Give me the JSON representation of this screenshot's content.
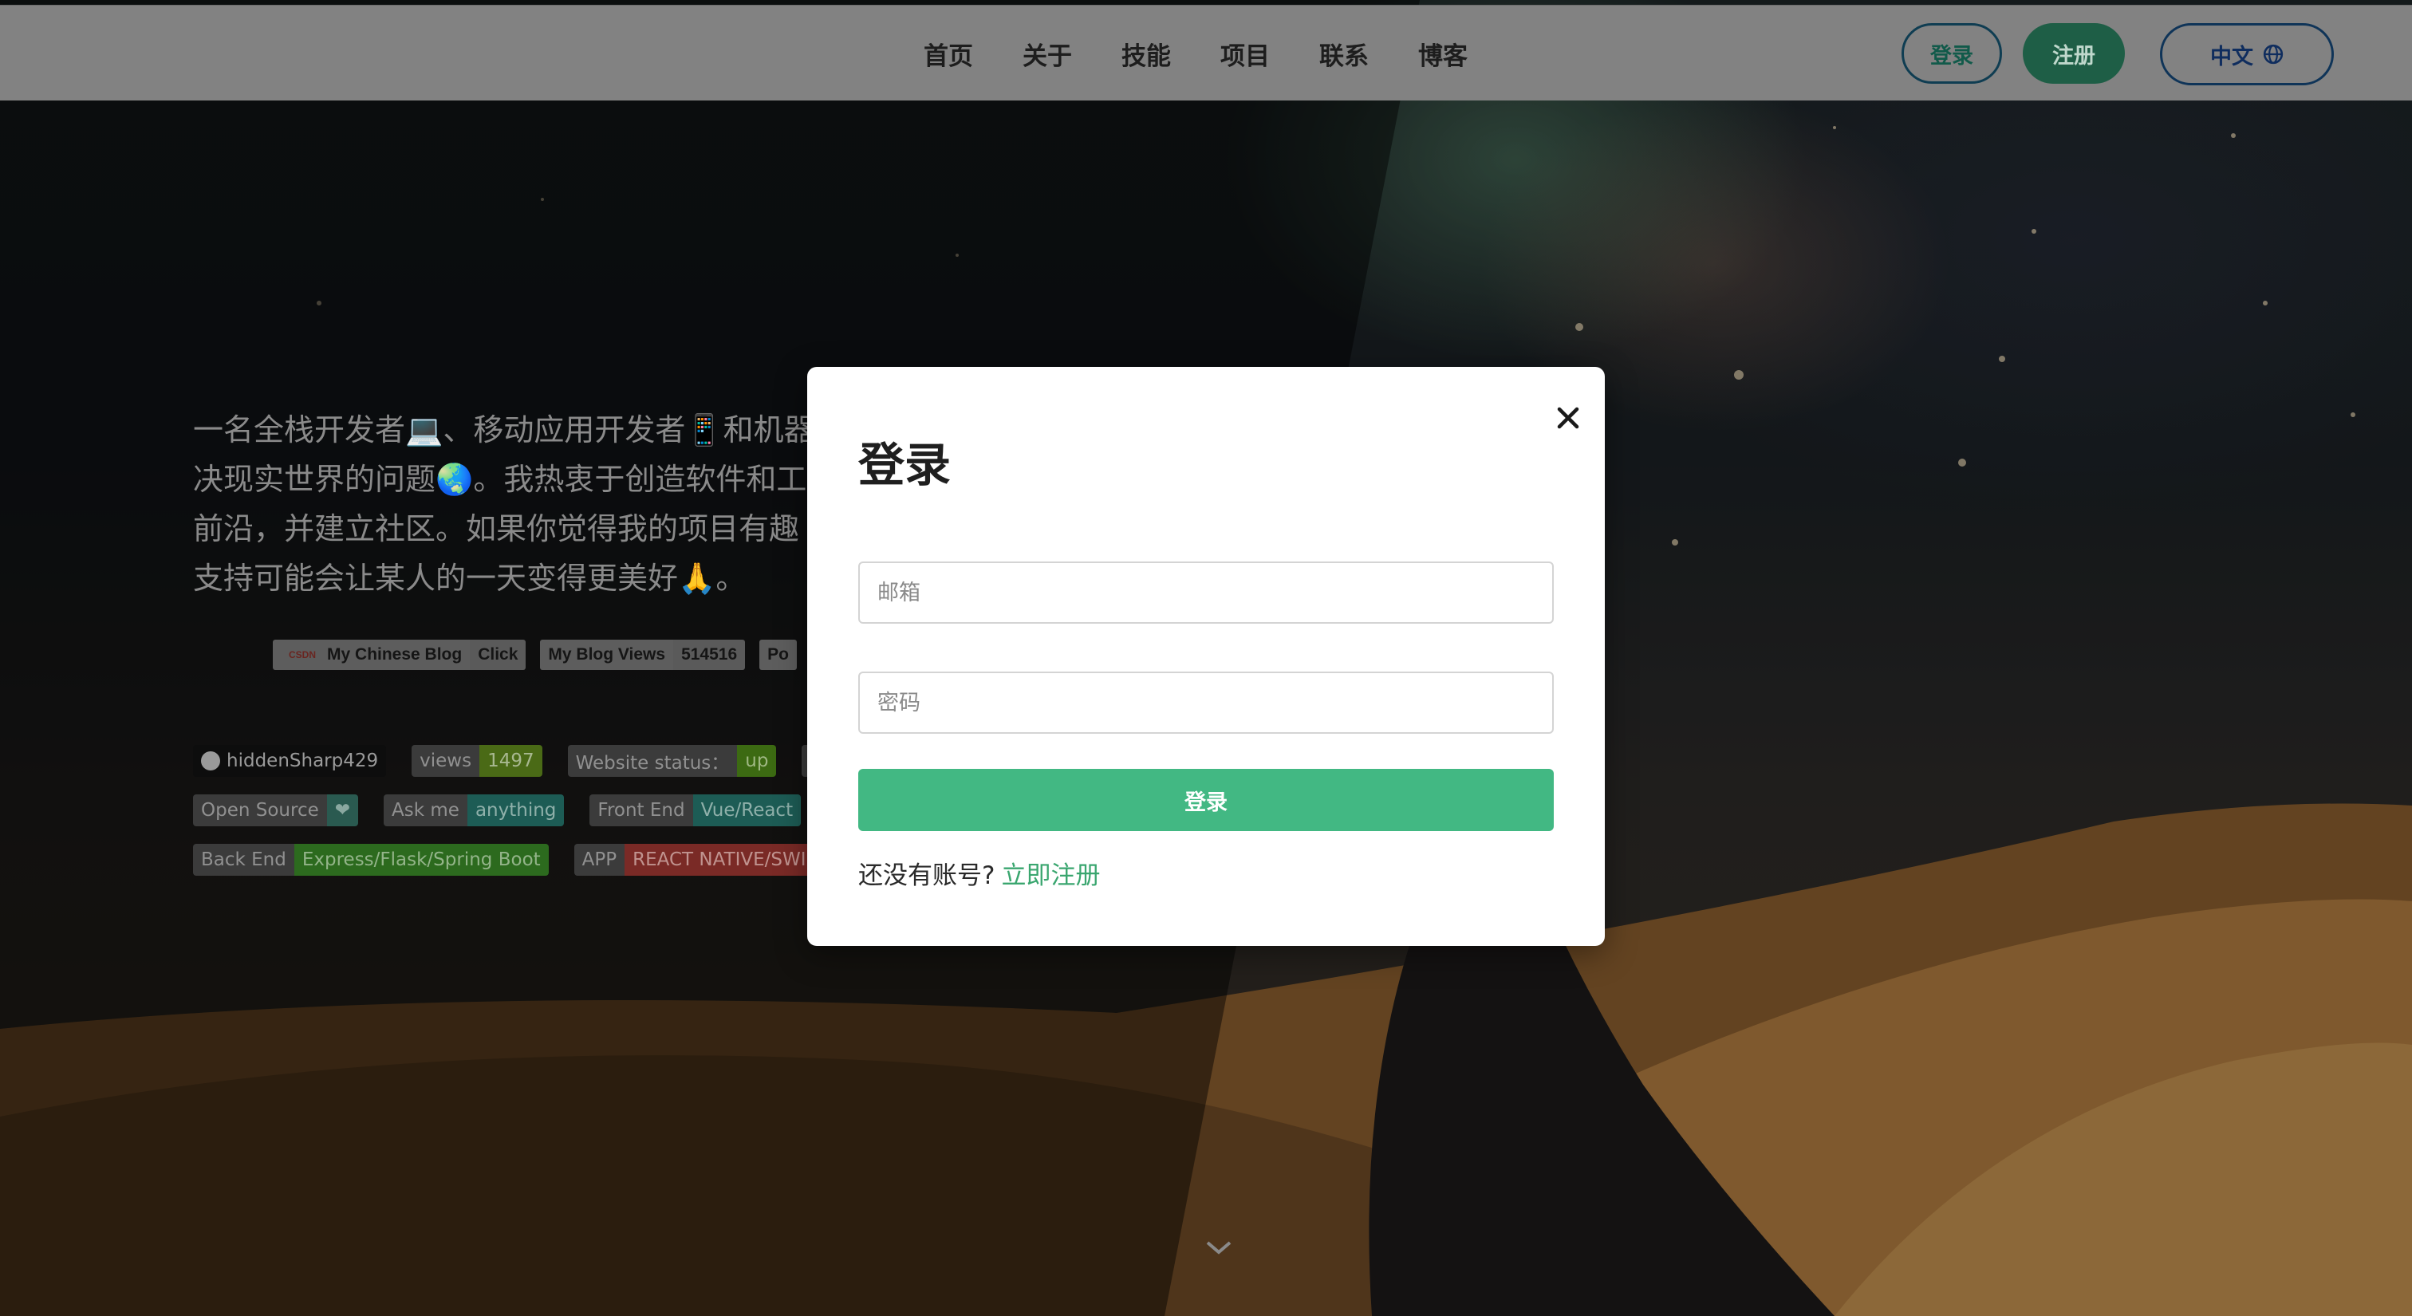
{
  "nav": {
    "links": [
      "首页",
      "关于",
      "技能",
      "项目",
      "联系",
      "博客"
    ],
    "login_label": "登录",
    "register_label": "注册",
    "language_label": "中文"
  },
  "hero": {
    "intro_lines": [
      "一名全栈开发者💻、移动应用开发者📱和机器",
      "决现实世界的问题🌏。我热衷于创造软件和工",
      "前沿，并建立社区。如果你觉得我的项目有趣",
      "支持可能会让某人的一天变得更美好🙏。"
    ],
    "blog_badges": [
      {
        "label": "My Chinese Blog",
        "prefix": "CSDN",
        "value": "Click"
      },
      {
        "label": "My Blog Views",
        "value": "514516"
      },
      {
        "label": "Po"
      }
    ],
    "badges": {
      "github_user": "hiddenSharp429",
      "views_label": "views",
      "views_value": "1497",
      "status_label": "Website status：",
      "status_value": "up",
      "open_source_label": "Open Source",
      "ask_label": "Ask me",
      "ask_value": "anything",
      "frontend_label": "Front End",
      "frontend_value": "Vue/React",
      "backend_label": "Back End",
      "backend_value": "Express/Flask/Spring Boot",
      "app_label": "APP",
      "app_value": "REACT NATIVE/SWIF"
    }
  },
  "modal": {
    "title": "登录",
    "email_placeholder": "邮箱",
    "password_placeholder": "密码",
    "submit_label": "登录",
    "no_account_text": "还没有账号?",
    "register_link": "立即注册"
  },
  "colors": {
    "accent": "#42b883",
    "register_link": "#3aa66f",
    "nav_bg": "#828282"
  }
}
